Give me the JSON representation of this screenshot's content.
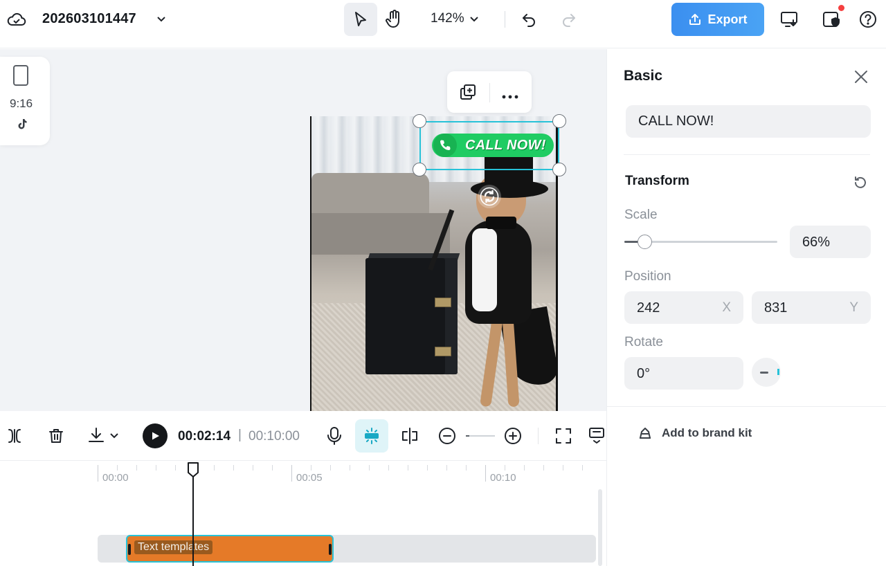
{
  "header": {
    "project_title": "202603101447",
    "zoom": "142%",
    "export_label": "Export"
  },
  "canvas": {
    "ratio_label": "9:16",
    "text_overlay": "CALL NOW!"
  },
  "panel": {
    "title": "Basic",
    "text_value": "CALL NOW!",
    "transform_title": "Transform",
    "scale_label": "Scale",
    "scale_value": "66%",
    "scale_fraction": 0.13,
    "position_label": "Position",
    "position_x": "242",
    "position_x_suffix": "X",
    "position_y": "831",
    "position_y_suffix": "Y",
    "rotate_label": "Rotate",
    "rotate_value": "0°",
    "brand_kit_label": "Add to brand kit"
  },
  "timeline": {
    "current_time": "00:02:14",
    "separator": "|",
    "total_time": "00:10:00",
    "ruler_labels": [
      "00:00",
      "00:05",
      "00:10"
    ],
    "clip_label": "Text templates"
  },
  "colors": {
    "accent": "#27c2d8",
    "export": "#3b8ff0",
    "clip": "#e57a28",
    "call_badge": "#1fcc63",
    "notification": "#f53f3f"
  }
}
